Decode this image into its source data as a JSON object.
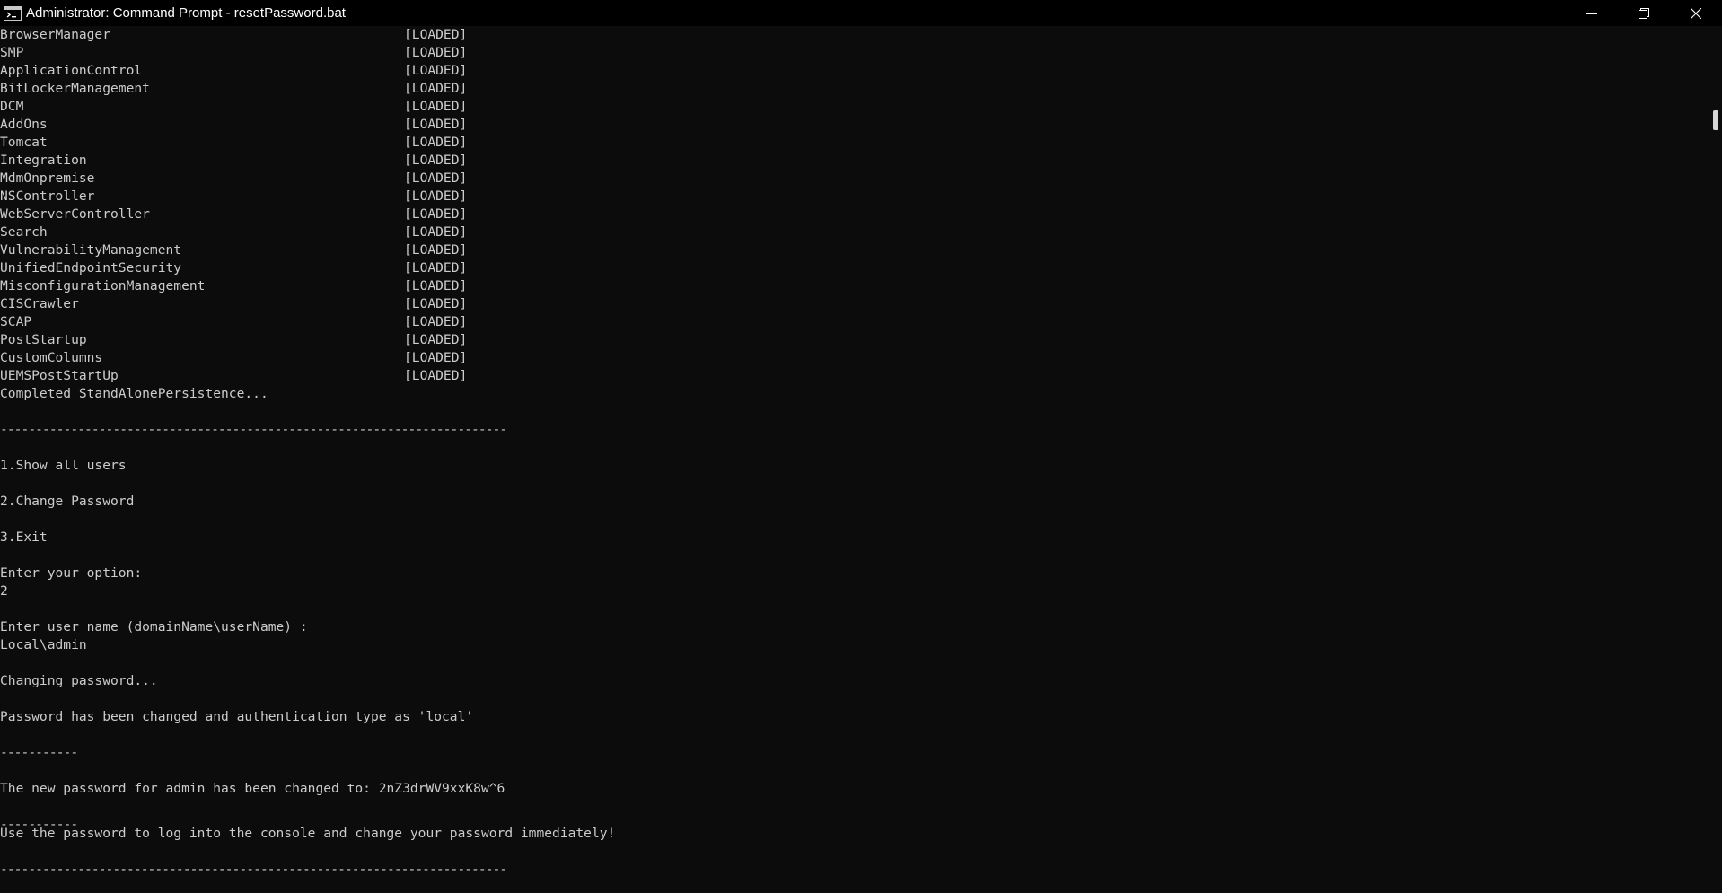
{
  "window": {
    "title": "Administrator: Command Prompt - resetPassword.bat",
    "icon": "cmd-icon",
    "controls": [
      "minimize-icon",
      "restore-icon",
      "close-icon"
    ]
  },
  "console": {
    "modules": [
      {
        "name": "BrowserManager",
        "status": "[LOADED]"
      },
      {
        "name": "SMP",
        "status": "[LOADED]"
      },
      {
        "name": "ApplicationControl",
        "status": "[LOADED]"
      },
      {
        "name": "BitLockerManagement",
        "status": "[LOADED]"
      },
      {
        "name": "DCM",
        "status": "[LOADED]"
      },
      {
        "name": "AddOns",
        "status": "[LOADED]"
      },
      {
        "name": "Tomcat",
        "status": "[LOADED]"
      },
      {
        "name": "Integration",
        "status": "[LOADED]"
      },
      {
        "name": "MdmOnpremise",
        "status": "[LOADED]"
      },
      {
        "name": "NSController",
        "status": "[LOADED]"
      },
      {
        "name": "WebServerController",
        "status": "[LOADED]"
      },
      {
        "name": "Search",
        "status": "[LOADED]"
      },
      {
        "name": "VulnerabilityManagement",
        "status": "[LOADED]"
      },
      {
        "name": "UnifiedEndpointSecurity",
        "status": "[LOADED]"
      },
      {
        "name": "MisconfigurationManagement",
        "status": "[LOADED]"
      },
      {
        "name": "CISCrawler",
        "status": "[LOADED]"
      },
      {
        "name": "SCAP",
        "status": "[LOADED]"
      },
      {
        "name": "PostStartup",
        "status": "[LOADED]"
      },
      {
        "name": "CustomColumns",
        "status": "[LOADED]"
      },
      {
        "name": "UEMSPostStartUp",
        "status": "[LOADED]"
      }
    ],
    "completed": "Completed StandAlonePersistence...",
    "separator_long": "------------------------------------------------------------------------",
    "menu": [
      "1.Show all users",
      "2.Change Password",
      "3.Exit"
    ],
    "prompt_option": "Enter your option:",
    "option_value": "2",
    "prompt_user": "Enter user name (domainName\\userName) :",
    "user_value": "Local\\admin",
    "changing": "Changing password...",
    "changed_msg": "Password has been changed and authentication type as 'local'",
    "separator_short": "-----------",
    "new_password_line": "The new password for admin has been changed to: 2nZ3drWV9xxK8w^6",
    "instruction": "Use the password to log into the console and change your password immediately!"
  },
  "colors": {
    "background": "#0c0c0c",
    "titlebar": "#000000",
    "text": "#cccccc"
  }
}
